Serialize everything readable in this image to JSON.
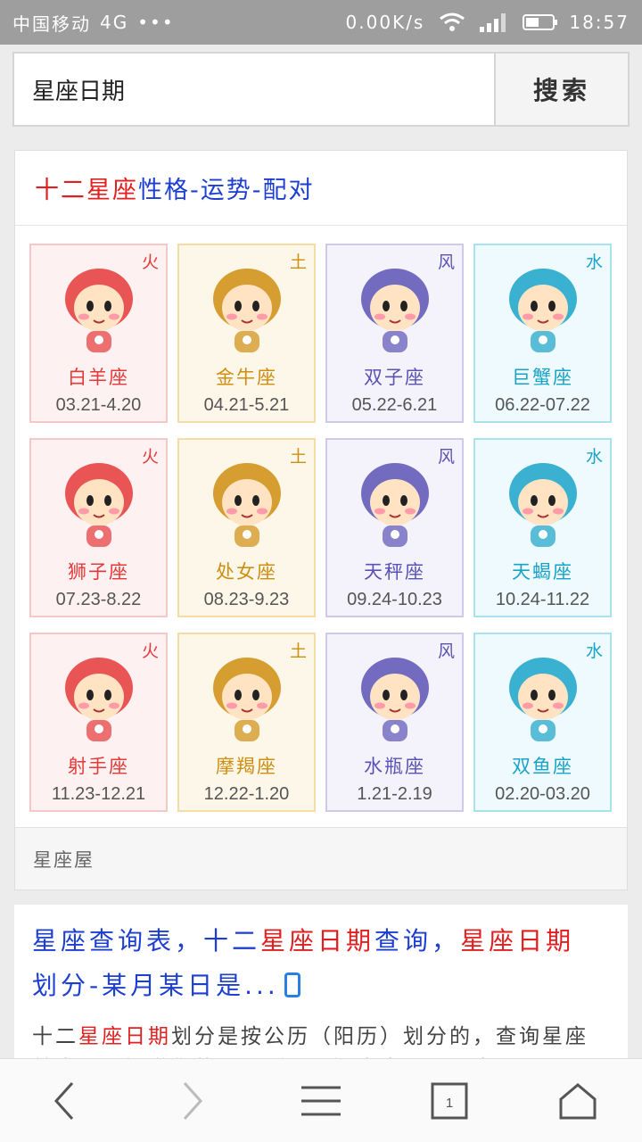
{
  "status": {
    "carrier": "中国移动",
    "network": "4G",
    "dots": "•••",
    "speed": "0.00K/s",
    "time": "18:57"
  },
  "search": {
    "query": "星座日期",
    "button": "搜索"
  },
  "card": {
    "title_red": "十二星座",
    "title_blue": "性格-运势-配对",
    "footer": "星座屋",
    "signs": [
      {
        "element": "火",
        "name": "白羊座",
        "dates": "03.21-4.20",
        "icon": "aries-icon",
        "color": "#e53838"
      },
      {
        "element": "土",
        "name": "金牛座",
        "dates": "04.21-5.21",
        "icon": "taurus-icon",
        "color": "#cf8e10"
      },
      {
        "element": "风",
        "name": "双子座",
        "dates": "05.22-6.21",
        "icon": "gemini-icon",
        "color": "#5a52b5"
      },
      {
        "element": "水",
        "name": "巨蟹座",
        "dates": "06.22-07.22",
        "icon": "cancer-icon",
        "color": "#1aa3c8"
      },
      {
        "element": "火",
        "name": "狮子座",
        "dates": "07.23-8.22",
        "icon": "leo-icon",
        "color": "#e53838"
      },
      {
        "element": "土",
        "name": "处女座",
        "dates": "08.23-9.23",
        "icon": "virgo-icon",
        "color": "#cf8e10"
      },
      {
        "element": "风",
        "name": "天秤座",
        "dates": "09.24-10.23",
        "icon": "libra-icon",
        "color": "#5a52b5"
      },
      {
        "element": "水",
        "name": "天蝎座",
        "dates": "10.24-11.22",
        "icon": "scorpio-icon",
        "color": "#1aa3c8"
      },
      {
        "element": "火",
        "name": "射手座",
        "dates": "11.23-12.21",
        "icon": "sagittarius-icon",
        "color": "#e53838"
      },
      {
        "element": "土",
        "name": "摩羯座",
        "dates": "12.22-1.20",
        "icon": "capricorn-icon",
        "color": "#cf8e10"
      },
      {
        "element": "风",
        "name": "水瓶座",
        "dates": "1.21-2.19",
        "icon": "aquarius-icon",
        "color": "#5a52b5"
      },
      {
        "element": "水",
        "name": "双鱼座",
        "dates": "02.20-03.20",
        "icon": "pisces-icon",
        "color": "#1aa3c8"
      }
    ]
  },
  "result": {
    "title_1": "星座",
    "title_2": "查询表，十二",
    "title_3": "星座日期",
    "title_4": "查询，",
    "title_5": "星座日期",
    "title_6": "划分-某月某日是...",
    "snippet_1": "十二",
    "snippet_2": "星座日期",
    "snippet_3": "划分是按公历（阳历）划分的，查询星座首先需要知道您的公历（阳历）出生日期，十二星"
  },
  "navbar": {
    "page_count": "1",
    "icons": [
      "back-icon",
      "forward-icon",
      "menu-icon",
      "tabs-icon",
      "home-icon"
    ]
  }
}
